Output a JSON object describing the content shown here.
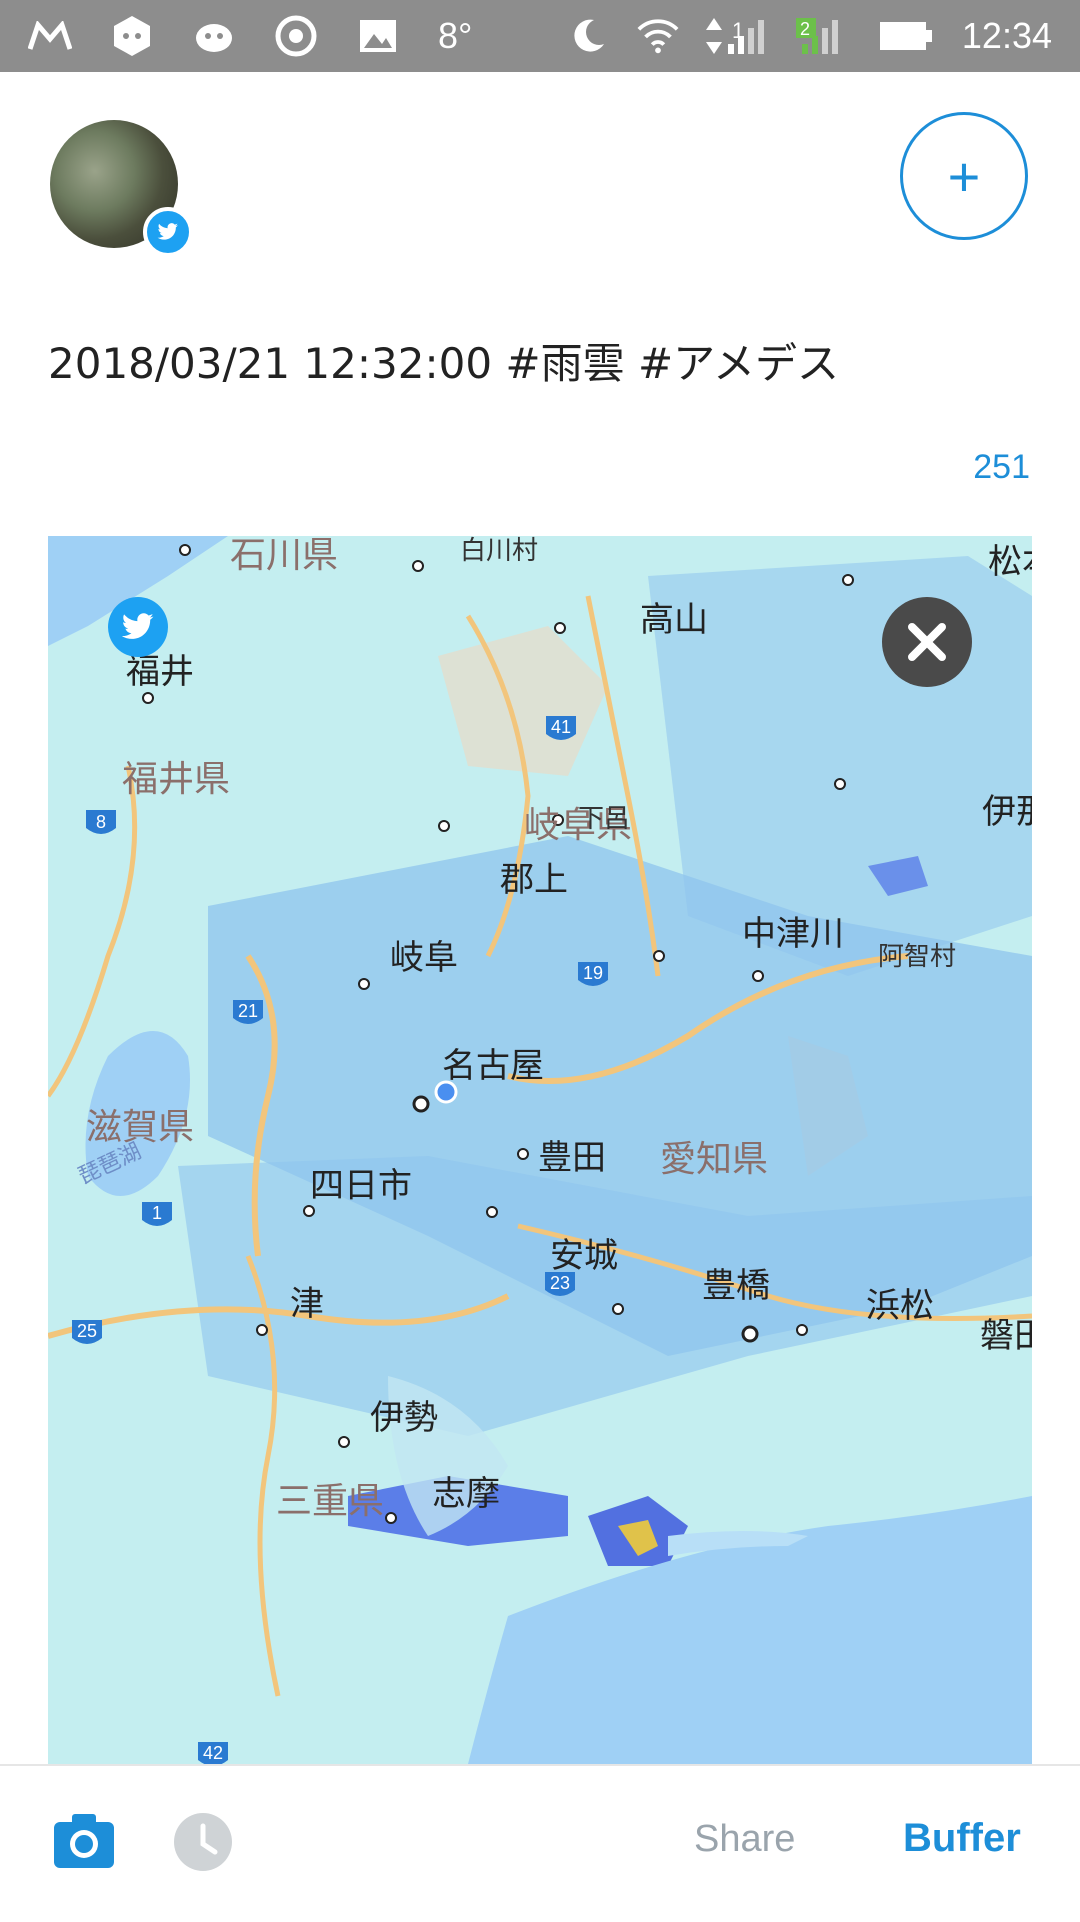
{
  "status_bar": {
    "temperature": "8°",
    "time": "12:34",
    "sim1_badge": "1",
    "sim2_badge": "2",
    "left_icons": [
      "gmail-icon",
      "notification-app-icon",
      "mascot-app-icon",
      "swirl-app-icon",
      "image-icon"
    ],
    "right_icons": [
      "moon-icon",
      "wifi-icon",
      "data-arrows-icon",
      "signal-icon",
      "signal-icon",
      "battery-icon"
    ]
  },
  "header": {
    "avatar_badge": "twitter-icon",
    "add_button": "+"
  },
  "post": {
    "text": "2018/03/21 12:32:00 #雨雲 #アメデス",
    "char_count": "251"
  },
  "map": {
    "labels": {
      "ishikawa": "石川県",
      "shirakawa": "白川村",
      "matsumoto": "松本",
      "takayama": "高山",
      "fukui": "福井",
      "fukui_pref": "福井県",
      "gifu_pref": "岐阜県",
      "gero": "下呂",
      "ina": "伊那",
      "gujo": "郡上",
      "gifu": "岐阜",
      "nakatsugawa": "中津川",
      "achi": "阿智村",
      "biwako": "琵琶湖",
      "nagoya": "名古屋",
      "shiga_pref": "滋賀県",
      "toyota": "豊田",
      "aichi_pref": "愛知県",
      "yokkaichi": "四日市",
      "anjo": "安城",
      "tsu": "津",
      "toyohashi": "豊橋",
      "hamamatsu": "浜松",
      "iwata": "磐田",
      "ise": "伊勢",
      "mie_pref": "三重県",
      "shima": "志摩"
    },
    "route_shields": [
      "41",
      "8",
      "19",
      "21",
      "1",
      "23",
      "25",
      "42"
    ],
    "colors": {
      "rain_light": "#bfeaf0",
      "rain_medium": "#8fc4ee",
      "rain_heavy": "#5778e6",
      "sea": "#9fd0f5",
      "road": "#f2c57c"
    }
  },
  "bottom_bar": {
    "camera_icon": "camera-icon",
    "clock_icon": "clock-icon",
    "share_label": "Share",
    "buffer_label": "Buffer"
  },
  "accent_color": "#1d8ed8"
}
